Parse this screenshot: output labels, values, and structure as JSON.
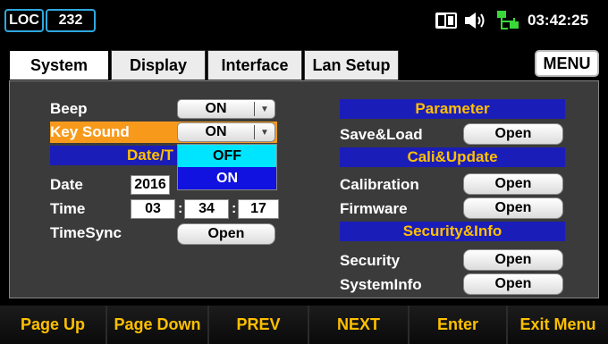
{
  "status_bar": {
    "mode": "LOC",
    "address": "232",
    "time": "03:42:25",
    "icons": [
      "usb-card-icon",
      "speaker-icon",
      "network-icon"
    ]
  },
  "tabs": [
    {
      "label": "System",
      "active": true
    },
    {
      "label": "Display",
      "active": false
    },
    {
      "label": "Interface",
      "active": false
    },
    {
      "label": "Lan Setup",
      "active": false
    }
  ],
  "menu_label": "MENU",
  "left": {
    "beep": {
      "label": "Beep",
      "value": "ON"
    },
    "key_sound": {
      "label": "Key Sound",
      "value": "ON"
    },
    "datetime_header": "Date/T",
    "date": {
      "label": "Date",
      "year": "2016"
    },
    "time": {
      "label": "Time",
      "hour": "03",
      "minute": "34",
      "second": "17"
    },
    "timesync": {
      "label": "TimeSync",
      "button": "Open"
    }
  },
  "dropdown": {
    "options": [
      "OFF",
      "ON"
    ],
    "highlighted": "OFF"
  },
  "right": {
    "parameter_header": "Parameter",
    "saveload": {
      "label": "Save&Load",
      "button": "Open"
    },
    "cali_header": "Cali&Update",
    "calibration": {
      "label": "Calibration",
      "button": "Open"
    },
    "firmware": {
      "label": "Firmware",
      "button": "Open"
    },
    "security_header": "Security&Info",
    "security": {
      "label": "Security",
      "button": "Open"
    },
    "systeminfo": {
      "label": "SystemInfo",
      "button": "Open"
    }
  },
  "softkeys": [
    "Page Up",
    "Page Down",
    "PREV",
    "NEXT",
    "Enter",
    "Exit Menu"
  ],
  "colors": {
    "accent_yellow": "#ffc000",
    "header_blue": "#1b1db8",
    "highlight_orange": "#f79a1c",
    "status_border": "#2ea8e0",
    "option_cyan": "#00e5ff"
  }
}
